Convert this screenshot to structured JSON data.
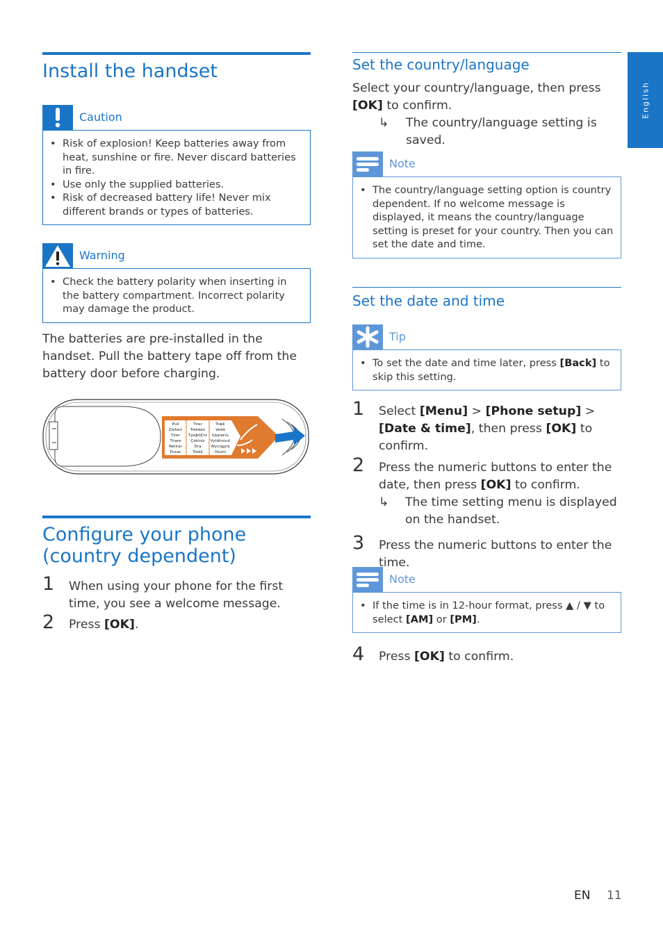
{
  "side_tab": {
    "label": "English"
  },
  "install": {
    "title": "Install the handset",
    "caution": {
      "label": "Caution",
      "items": [
        "Risk of explosion! Keep batteries away from heat, sunshine or fire. Never discard batteries in fire.",
        "Use only the supplied batteries.",
        "Risk of decreased battery life! Never mix different brands or types of batteries."
      ]
    },
    "warning": {
      "label": "Warning",
      "items": [
        "Check the battery polarity when inserting in the battery compartment. Incorrect polarity may damage the product."
      ]
    },
    "body": "The batteries are pre-installed in the handset. Pull the battery tape off from the battery door before charging.",
    "tape_labels": {
      "col1": [
        "Pull",
        "Ziehen",
        "Tirer",
        "Tirare",
        "Retirar",
        "Puxar"
      ],
      "col2": [
        "Tirar",
        "Trekken",
        "Τραβήξτε",
        "Çekiniz",
        "Dra",
        "Trekk"
      ],
      "col3": [
        "Træk",
        "Vedä",
        "Удалить",
        "Vytáhnout",
        "Wyciągnij",
        "Húzni"
      ]
    }
  },
  "configure": {
    "title_line1": "Configure your phone",
    "title_line2": "(country dependent)",
    "steps": [
      {
        "num": "1",
        "text": "When using your phone for the first time, you see a welcome message."
      },
      {
        "num": "2",
        "pre": "Press ",
        "key": "[OK]",
        "post": "."
      }
    ]
  },
  "country": {
    "title": "Set the country/language",
    "body_pre": "Select your country/language, then press ",
    "body_key": "[OK]",
    "body_post": " to confirm.",
    "result": "The country/language setting is saved.",
    "note": {
      "label": "Note",
      "items": [
        "The country/language setting option is country dependent. If no welcome message is displayed, it means the country/language setting is preset for your country. Then you can set the date and time."
      ]
    }
  },
  "datetime": {
    "title": "Set the date and time",
    "tip": {
      "label": "Tip",
      "pre": "To set the date and time later, press ",
      "key": "[Back]",
      "post": " to skip this setting."
    },
    "step1": {
      "num": "1",
      "t1": "Select ",
      "k1": "[Menu]",
      "t2": " > ",
      "k2": "[Phone setup]",
      "t3": " > ",
      "k3": "[Date & time]",
      "t4": ", then press ",
      "k4": "[OK]",
      "t5": " to confirm."
    },
    "step2": {
      "num": "2",
      "t1": "Press the numeric buttons to enter the date, then press ",
      "k1": "[OK]",
      "t2": " to confirm.",
      "result": "The time setting menu is displayed on the handset."
    },
    "step3": {
      "num": "3",
      "text": "Press the numeric buttons to enter the time."
    },
    "note": {
      "label": "Note",
      "pre": "If the time is in 12-hour format, press ",
      "sep": " / ",
      "mid": " to select ",
      "k1": "[AM]",
      "or": " or ",
      "k2": "[PM]",
      "post": "."
    },
    "step4": {
      "num": "4",
      "pre": "Press ",
      "key": "[OK]",
      "post": " to confirm."
    }
  },
  "footer": {
    "lang": "EN",
    "page": "11"
  },
  "colors": {
    "accent": "#1a75c7",
    "accent_light": "#5e97d9",
    "tape": "#e07a2e"
  }
}
